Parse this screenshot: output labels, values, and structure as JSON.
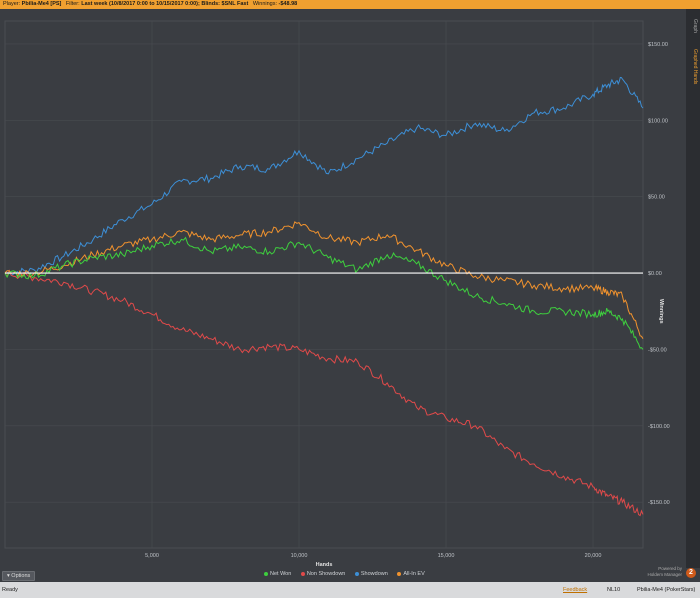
{
  "header": {
    "player_label": "Player:",
    "player": "Pbilia-Me4 [PS]",
    "filter_label": "Filter:",
    "filter": "Last week (10/8/2017 0:00 to 10/15/2017 0:00); Blinds: $SNL Fast",
    "winnings_label": "Winnings:",
    "winnings": "-$48.98"
  },
  "side_tabs": [
    "Graph",
    "Graphed Hands"
  ],
  "colors": {
    "net_won": "#3ecf3e",
    "non_showdown": "#e04a4a",
    "showdown": "#3d8fd6",
    "allin_ev": "#f0922e",
    "zero_line": "#ffffff",
    "background": "#3a3d42"
  },
  "chart_data": {
    "type": "line",
    "xlabel": "Hands",
    "ylabel": "Winnings",
    "xlim": [
      0,
      21700
    ],
    "ylim": [
      -180,
      165
    ],
    "xticks": [
      5000,
      10000,
      15000,
      20000
    ],
    "xtick_labels": [
      "5,000",
      "10,000",
      "15,000",
      "20,000"
    ],
    "yticks": [
      150,
      100,
      50,
      0,
      -50,
      -100,
      -150
    ],
    "ytick_labels": [
      "$150.00",
      "$100.00",
      "$50.00",
      "$0.00",
      "-$50.00",
      "-$100.00",
      "-$150.00"
    ],
    "grid": true,
    "legend_position": "bottom-center",
    "x": [
      0,
      1000,
      2000,
      3000,
      4000,
      5000,
      6000,
      7000,
      8000,
      9000,
      10000,
      11000,
      12000,
      13000,
      14000,
      15000,
      16000,
      17000,
      18000,
      19000,
      20000,
      20500,
      21000,
      21700
    ],
    "series": [
      {
        "name": "Net Won",
        "color": "#3ecf3e",
        "values": [
          0,
          -2,
          5,
          10,
          12,
          18,
          22,
          14,
          17,
          14,
          20,
          10,
          2,
          12,
          6,
          -5,
          -15,
          -20,
          -25,
          -25,
          -27,
          -25,
          -30,
          -50
        ]
      },
      {
        "name": "Non Showdown",
        "color": "#e04a4a",
        "values": [
          0,
          -3,
          -6,
          -12,
          -18,
          -27,
          -37,
          -43,
          -50,
          -48,
          -50,
          -56,
          -58,
          -72,
          -88,
          -95,
          -100,
          -115,
          -125,
          -133,
          -140,
          -146,
          -150,
          -158
        ]
      },
      {
        "name": "Showdown",
        "color": "#3d8fd6",
        "values": [
          0,
          2,
          11,
          22,
          35,
          45,
          60,
          62,
          70,
          68,
          80,
          65,
          75,
          85,
          95,
          90,
          98,
          93,
          105,
          108,
          117,
          123,
          127,
          108
        ]
      },
      {
        "name": "All-In EV",
        "color": "#f0922e",
        "values": [
          0,
          0,
          5,
          12,
          18,
          22,
          27,
          22,
          25,
          27,
          33,
          23,
          20,
          25,
          15,
          5,
          -2,
          -5,
          -8,
          -10,
          -10,
          -12,
          -15,
          -43
        ]
      }
    ],
    "zero_line": 0
  },
  "legend": [
    "Net Won",
    "Non Showdown",
    "Showdown",
    "All-In EV"
  ],
  "options_label": "Options",
  "powered_by": "Powered by",
  "brand": "Holdem Manager",
  "brand_mark": "2",
  "status": {
    "ready": "Ready",
    "feedback": "Feedback",
    "stake": "NL10",
    "player": "Pbilia-Me4 (PokerStars)"
  }
}
